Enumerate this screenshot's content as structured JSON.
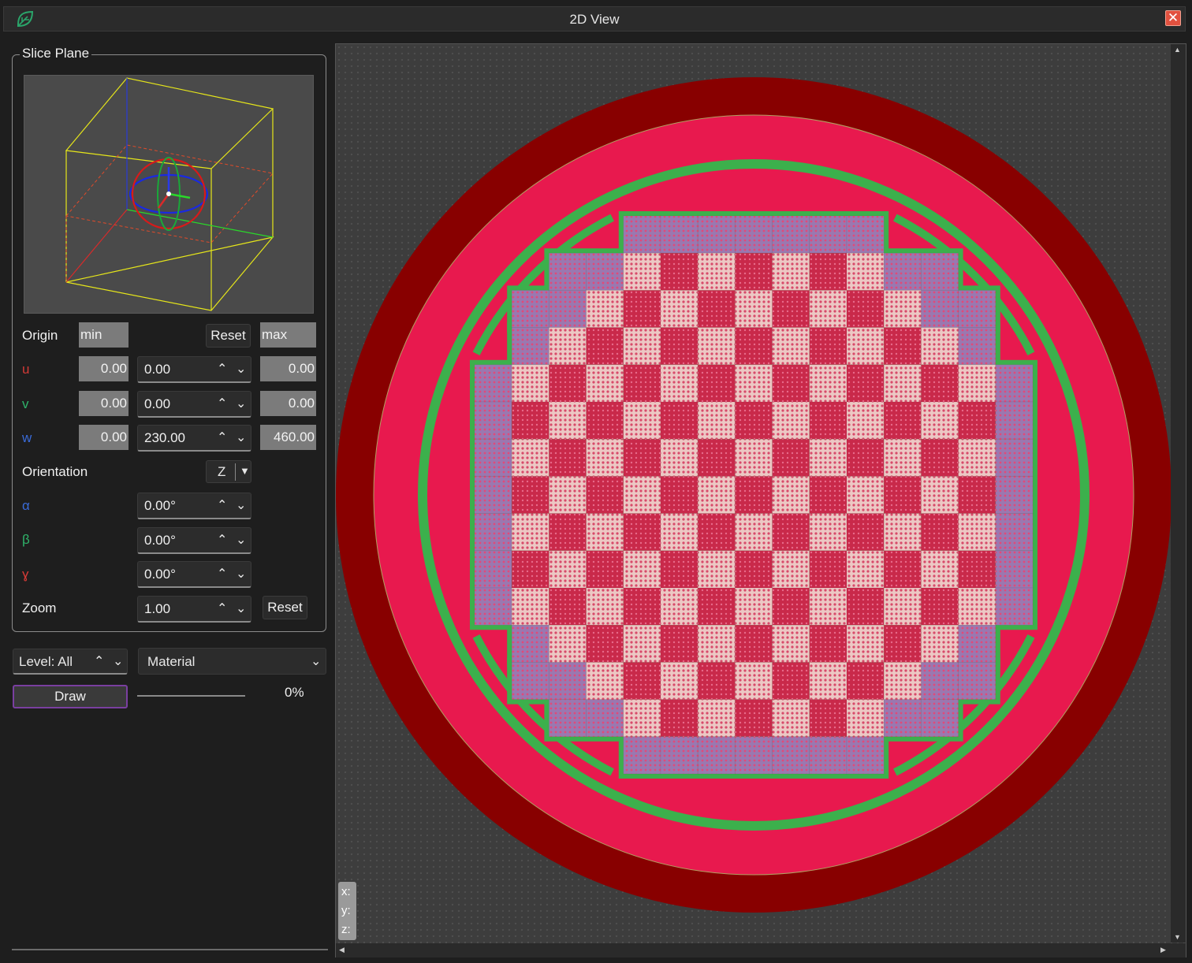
{
  "window": {
    "title": "2D View",
    "close": "✕"
  },
  "slice_plane": {
    "group_title": "Slice Plane",
    "origin_label": "Origin",
    "min_label": "min",
    "reset_label": "Reset",
    "max_label": "max",
    "axes": [
      {
        "label": "u",
        "min": "0.00",
        "value": "0.00",
        "max": "0.00"
      },
      {
        "label": "v",
        "min": "0.00",
        "value": "0.00",
        "max": "0.00"
      },
      {
        "label": "w",
        "min": "0.00",
        "value": "230.00",
        "max": "460.00"
      }
    ],
    "orientation_label": "Orientation",
    "orientation_value": "Z",
    "angles": [
      {
        "label": "α",
        "value": "0.00°"
      },
      {
        "label": "β",
        "value": "0.00°"
      },
      {
        "label": "ɣ",
        "value": "0.00°"
      }
    ],
    "zoom_label": "Zoom",
    "zoom_value": "1.00",
    "zoom_reset_label": "Reset"
  },
  "controls": {
    "level_value": "Level: All",
    "material_value": "Material",
    "draw_label": "Draw",
    "progress_percent": "0%",
    "progress_fraction": 0
  },
  "viewport": {
    "coord_labels": [
      "x:",
      "y:",
      "z:"
    ],
    "colors": {
      "background": "#3d3d3d",
      "outer_ring": "#880000",
      "inner_disk": "#e8194e",
      "shield": "#3cb04c",
      "dark_cell": "#c9294a",
      "light_cell": "#ecc8c4",
      "edge_cell": "#9a78b0"
    }
  },
  "icons": {
    "app": "app-leaf-icon",
    "close": "close-icon",
    "spin_up": "⌃",
    "spin_down": "⌄",
    "dropdown": "⌄"
  }
}
